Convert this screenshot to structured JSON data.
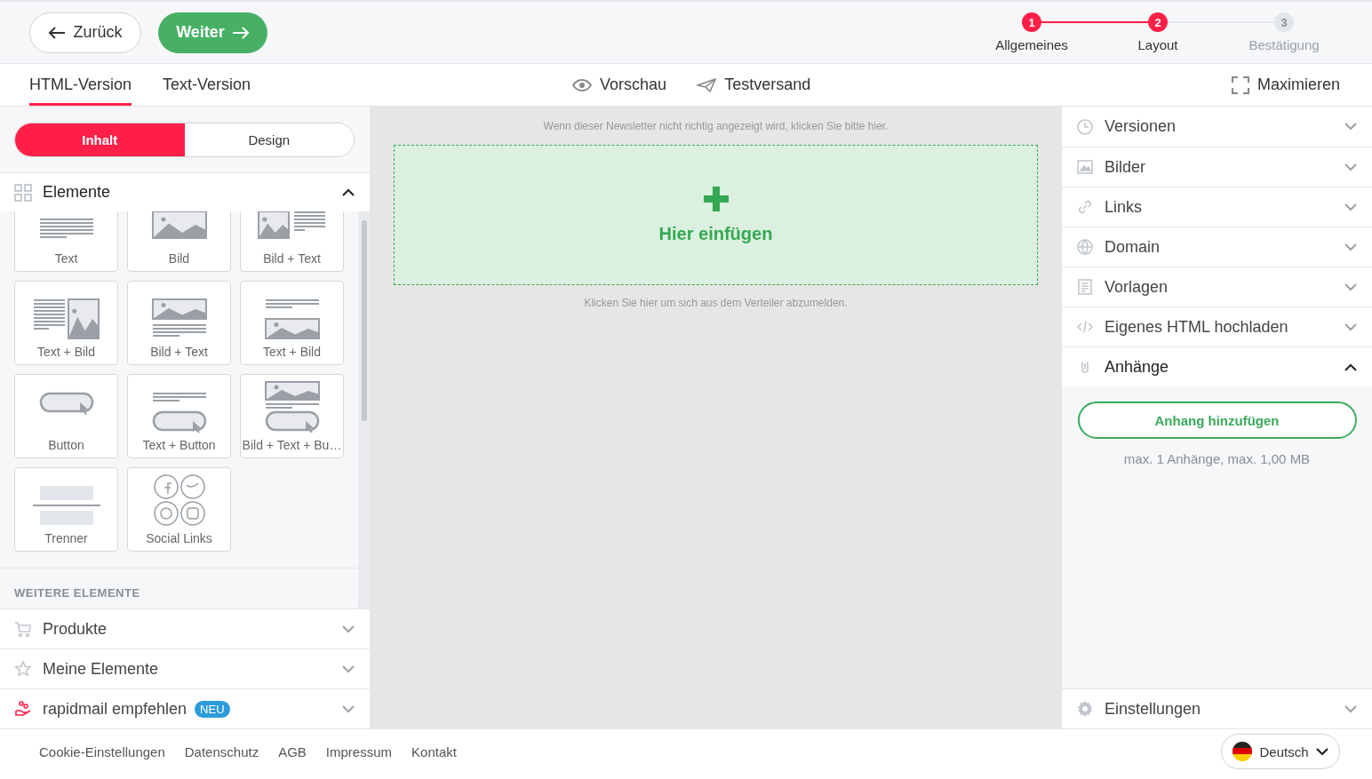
{
  "header": {
    "back_button": "Zurück",
    "next_button": "Weiter",
    "steps": [
      {
        "number": "1",
        "label": "Allgemeines",
        "active": true
      },
      {
        "number": "2",
        "label": "Layout",
        "active": true
      },
      {
        "number": "3",
        "label": "Bestätigung",
        "active": false
      }
    ]
  },
  "tabs": [
    {
      "label": "HTML-Version",
      "selected": true
    },
    {
      "label": "Text-Version",
      "selected": false
    }
  ],
  "toolbar": {
    "preview": "Vorschau",
    "test_send": "Testversand",
    "maximize": "Maximieren"
  },
  "left_panel": {
    "toggle": [
      {
        "label": "Inhalt",
        "selected": true
      },
      {
        "label": "Design",
        "selected": false
      }
    ],
    "elements_section": {
      "title": "Elemente",
      "expanded": true
    },
    "tiles": [
      {
        "label": "Text",
        "kind": "text"
      },
      {
        "label": "Bild",
        "kind": "image"
      },
      {
        "label": "Bild + Text",
        "kind": "imageside"
      },
      {
        "label": "Text + Bild",
        "kind": "textside"
      },
      {
        "label": "Bild + Text",
        "kind": "imagetop"
      },
      {
        "label": "Text + Bild",
        "kind": "textimage"
      },
      {
        "label": "Button",
        "kind": "button"
      },
      {
        "label": "Text + Button",
        "kind": "textbutton"
      },
      {
        "label": "Bild + Text + Bu…",
        "kind": "imagetextbutton"
      },
      {
        "label": "Trenner",
        "kind": "divider"
      },
      {
        "label": "Social Links",
        "kind": "social"
      }
    ],
    "more_heading": "WEITERE ELEMENTE",
    "sections": [
      {
        "title": "Produkte",
        "expanded": false
      },
      {
        "title": "Meine Elemente",
        "expanded": false
      },
      {
        "title": "rapidmail empfehlen",
        "badge": "NEU",
        "expanded": false
      }
    ]
  },
  "canvas": {
    "top_note": "Wenn dieser Newsletter nicht richtig angezeigt wird, klicken Sie bitte hier.",
    "drop_zone": "Hier einfügen",
    "bottom_note": "Klicken Sie hier um sich aus dem Verteiler abzumelden."
  },
  "right_panel": {
    "sections": [
      {
        "title": "Versionen",
        "expanded": false
      },
      {
        "title": "Bilder",
        "expanded": false
      },
      {
        "title": "Links",
        "expanded": false
      },
      {
        "title": "Domain",
        "expanded": false
      },
      {
        "title": "Vorlagen",
        "expanded": false
      },
      {
        "title": "Eigenes HTML hochladen",
        "expanded": false
      },
      {
        "title": "Anhänge",
        "expanded": true
      }
    ],
    "attachment_button": "Anhang hinzufügen",
    "attachment_note": "max. 1 Anhänge, max. 1,00 MB",
    "settings": {
      "title": "Einstellungen",
      "expanded": false
    }
  },
  "footer": {
    "links": [
      "Cookie-Einstellungen",
      "Datenschutz",
      "AGB",
      "Impressum",
      "Kontakt"
    ],
    "language": "Deutsch"
  }
}
